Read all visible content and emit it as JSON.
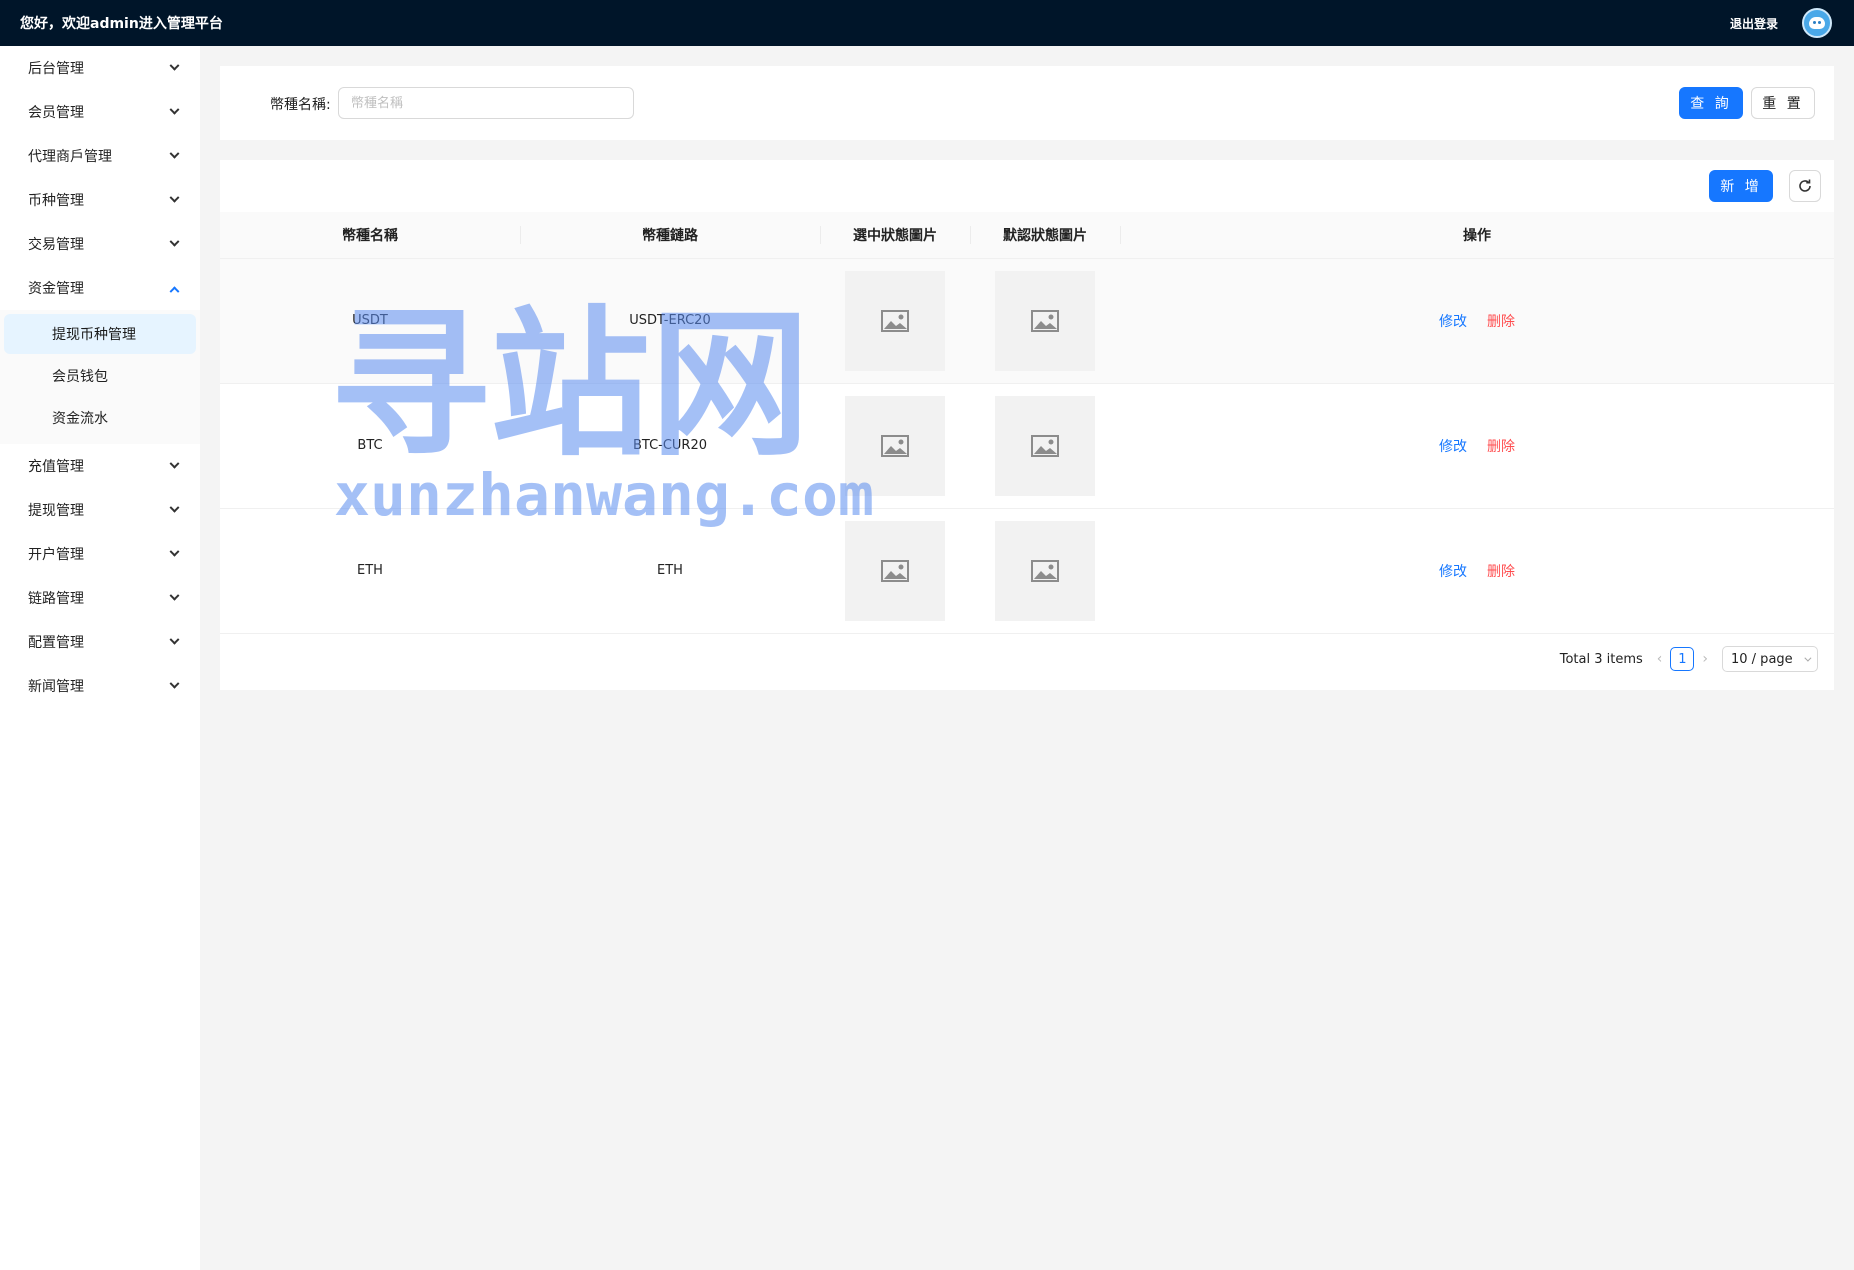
{
  "header": {
    "greeting": "您好，欢迎admin进入管理平台",
    "logout_label": "退出登录",
    "avatar_icon": "avatar-icon"
  },
  "sidebar": {
    "items": [
      {
        "label": "后台管理",
        "expanded": false
      },
      {
        "label": "会员管理",
        "expanded": false
      },
      {
        "label": "代理商戶管理",
        "expanded": false
      },
      {
        "label": "币种管理",
        "expanded": false
      },
      {
        "label": "交易管理",
        "expanded": false
      },
      {
        "label": "资金管理",
        "expanded": true
      },
      {
        "label": "充值管理",
        "expanded": false
      },
      {
        "label": "提现管理",
        "expanded": false
      },
      {
        "label": "开户管理",
        "expanded": false
      },
      {
        "label": "链路管理",
        "expanded": false
      },
      {
        "label": "配置管理",
        "expanded": false
      },
      {
        "label": "新闻管理",
        "expanded": false
      }
    ],
    "subitems": [
      {
        "label": "提现币种管理",
        "active": true
      },
      {
        "label": "会员钱包",
        "active": false
      },
      {
        "label": "资金流水",
        "active": false
      }
    ]
  },
  "search": {
    "label": "幣種名稱:",
    "placeholder": "幣種名稱",
    "value": "",
    "query_label": "查 詢",
    "reset_label": "重 置"
  },
  "table": {
    "add_label": "新 增",
    "columns": [
      "幣種名稱",
      "幣種鏈路",
      "選中狀態圖片",
      "默認狀態圖片",
      "操作"
    ],
    "rows": [
      {
        "name": "USDT",
        "chain": "USDT-ERC20",
        "edit": "修改",
        "delete": "删除"
      },
      {
        "name": "BTC",
        "chain": "BTC-CUR20",
        "edit": "修改",
        "delete": "删除"
      },
      {
        "name": "ETH",
        "chain": "ETH",
        "edit": "修改",
        "delete": "删除"
      }
    ]
  },
  "pagination": {
    "total_text": "Total 3 items",
    "current_page": "1",
    "page_size": "10 / page"
  },
  "watermark": {
    "title": "寻站网",
    "url": "xunzhanwang.com"
  },
  "colors": {
    "topbar": "#001529",
    "primary": "#1677ff",
    "danger": "#ff4d4f",
    "watermark": "#5b8df0"
  }
}
